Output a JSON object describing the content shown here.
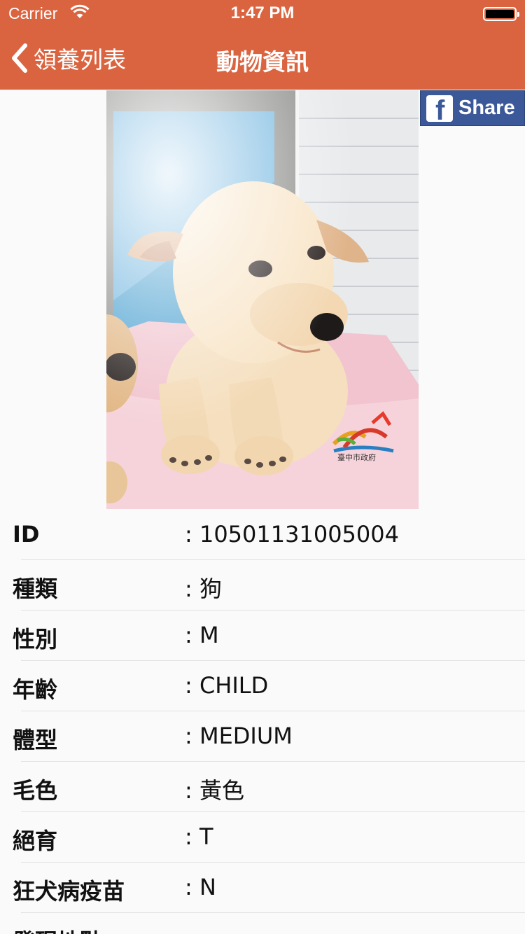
{
  "status_bar": {
    "carrier": "Carrier",
    "time": "1:47 PM"
  },
  "nav": {
    "back_label": "領養列表",
    "title": "動物資訊"
  },
  "share": {
    "label": "Share"
  },
  "info_rows": [
    {
      "label": "ID",
      "value": ": 10501131005004"
    },
    {
      "label": "種類",
      "value": ": 狗"
    },
    {
      "label": "性別",
      "value": ": M"
    },
    {
      "label": "年齡",
      "value": ": CHILD"
    },
    {
      "label": "體型",
      "value": ": MEDIUM"
    },
    {
      "label": "毛色",
      "value": ": 黃色"
    },
    {
      "label": "絕育",
      "value": ": T"
    },
    {
      "label": "狂犬病疫苗",
      "value": ": N"
    },
    {
      "label": "發現地點",
      "value": ""
    }
  ],
  "colors": {
    "nav_bar": "#db6440",
    "facebook": "#3b5998"
  },
  "icons": [
    "wifi-icon",
    "battery-icon",
    "back-chevron-icon",
    "facebook-icon"
  ],
  "photo": {
    "watermark_text": "臺中市政府"
  }
}
